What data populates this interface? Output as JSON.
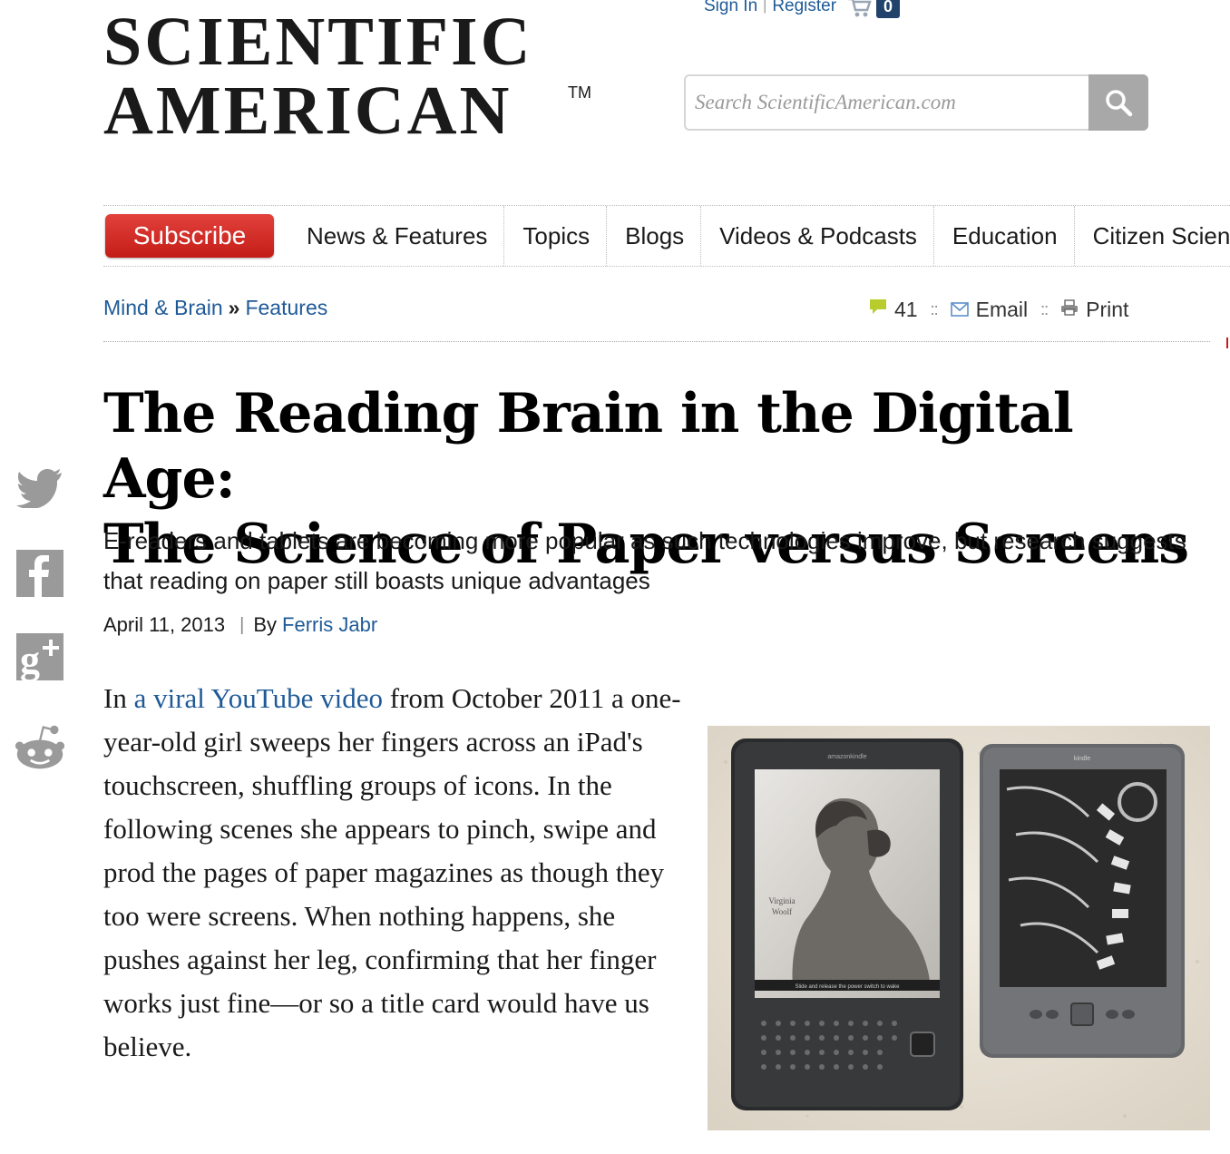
{
  "header": {
    "logo_line1": "SCIENTIFIC",
    "logo_line2": "AMERICAN",
    "logo_tm": "TM",
    "sign_in": "Sign In",
    "separator": "|",
    "register": "Register",
    "cart_count": "0",
    "search_placeholder": "Search ScientificAmerican.com"
  },
  "nav": {
    "subscribe": "Subscribe",
    "items": [
      "News & Features",
      "Topics",
      "Blogs",
      "Videos & Podcasts",
      "Education",
      "Citizen Science"
    ]
  },
  "breadcrumb": {
    "section": "Mind & Brain",
    "separator": "»",
    "subsection": "Features"
  },
  "tools": {
    "comments_count": "41",
    "email": "Email",
    "print": "Print",
    "dots": "::"
  },
  "article": {
    "title_line1": "The Reading Brain in the Digital Age:",
    "title_line2": "The Science of Paper versus Screens",
    "dek": "E-readers and tablets are becoming more popular as such technologies improve, but research suggests that reading on paper still boasts unique advantages",
    "date": "April 11, 2013",
    "byline_sep": "|",
    "by": "By",
    "author": "Ferris Jabr",
    "body_prefix": "In ",
    "body_link": "a viral YouTube video",
    "body_rest": " from October 2011 a one-year-old girl sweeps her fingers across an iPad's touchscreen, shuffling groups of icons. In the following scenes she appears to pinch, swipe and prod the pages of paper magazines as though they too were screens. When nothing happens, she pushes against her leg, confirming that her finger works just fine—or so a title card would have us believe."
  },
  "photo": {
    "kindle_left_brand": "amazonkindle",
    "kindle_right_brand": "kindle",
    "caption_name_line1": "Virginia",
    "caption_name_line2": "Woolf",
    "screen_footer": "Slide and release the power switch to wake"
  },
  "social": [
    "twitter-icon",
    "facebook-icon",
    "google-plus-icon",
    "reddit-icon"
  ],
  "colors": {
    "link": "#1f5a97",
    "subscribe": "#d42d27",
    "cart_badge": "#21426b",
    "comment_icon": "#b9cc2e"
  }
}
